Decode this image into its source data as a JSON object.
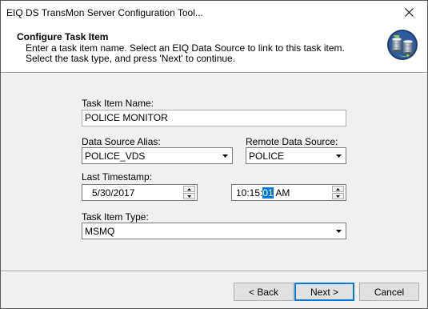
{
  "window": {
    "title": "EIQ DS TransMon Server Configuration Tool...",
    "close_glyph": "close-icon"
  },
  "header": {
    "title": "Configure Task Item",
    "description": "Enter a task item name.  Select an EIQ Data Source to link to this task item.  Select the task type, and press 'Next' to continue.",
    "icon": "database-sync-icon"
  },
  "form": {
    "task_item_name": {
      "label": "Task Item Name:",
      "value": "POLICE MONITOR"
    },
    "data_source_alias": {
      "label": "Data Source Alias:",
      "value": "POLICE_VDS"
    },
    "remote_data_source": {
      "label": "Remote Data Source:",
      "value": "POLICE"
    },
    "last_timestamp": {
      "label": "Last Timestamp:",
      "date": "5/30/2017",
      "time_prefix": "10:15:",
      "time_selected": "01",
      "time_suffix": " AM"
    },
    "task_item_type": {
      "label": "Task Item Type:",
      "value": "MSMQ"
    }
  },
  "buttons": {
    "back": "< Back",
    "next": "Next >",
    "cancel": "Cancel"
  },
  "colors": {
    "selection": "#0078d7",
    "header_bg": "#ffffff",
    "dialog_bg": "#f0f0f0"
  }
}
